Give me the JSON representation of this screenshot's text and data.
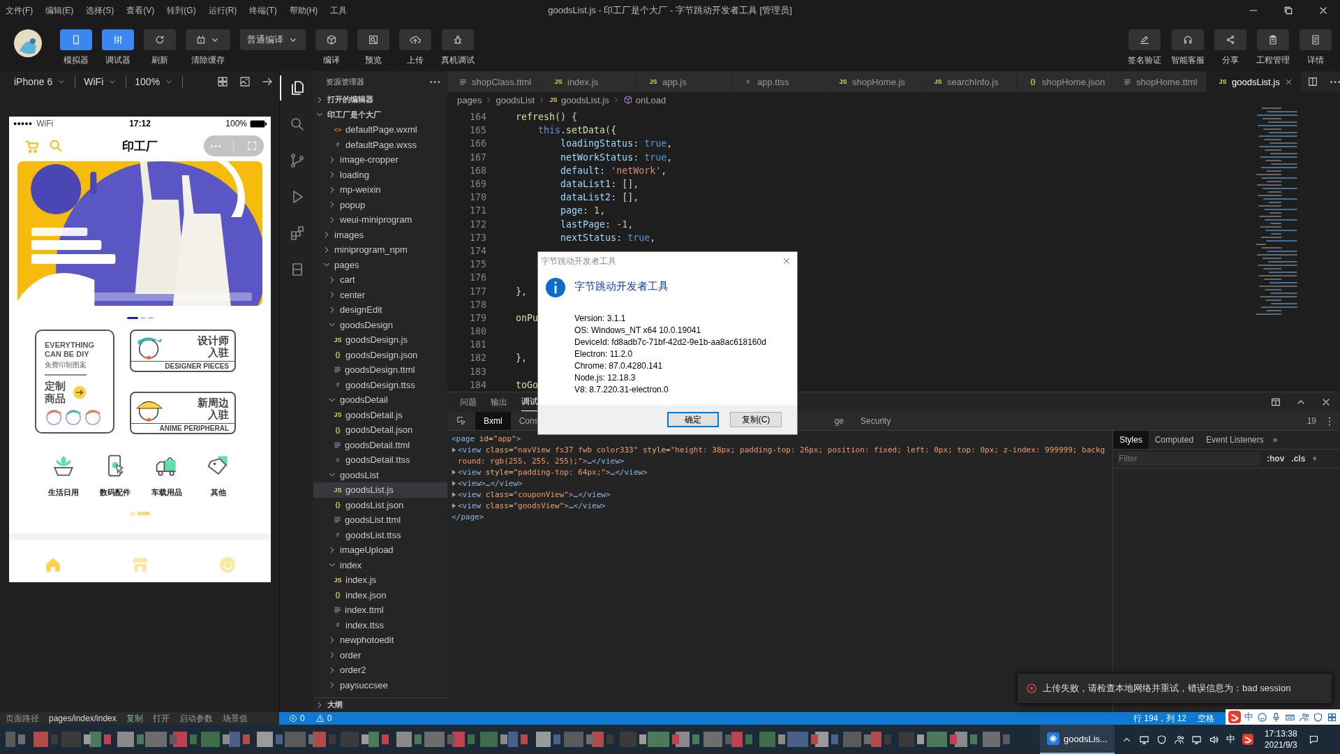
{
  "window": {
    "title": "goodsList.js - 印工厂是个大厂 - 字节跳动开发者工具 [管理员]"
  },
  "menu": [
    "文件(F)",
    "编辑(E)",
    "选择(S)",
    "查看(V)",
    "转到(G)",
    "运行(R)",
    "终端(T)",
    "帮助(H)",
    "工具"
  ],
  "toolbar": {
    "left": [
      {
        "label": "模拟器",
        "kind": "toggle",
        "on": true
      },
      {
        "label": "调试器",
        "kind": "toggle",
        "on": true
      },
      {
        "label": "刷新",
        "kind": "button"
      },
      {
        "label": "清除缓存",
        "kind": "dropdown"
      },
      {
        "label": "普通编译",
        "kind": "select"
      },
      {
        "label": "编译",
        "kind": "button"
      },
      {
        "label": "预览",
        "kind": "button"
      },
      {
        "label": "上传",
        "kind": "button"
      },
      {
        "label": "真机调试",
        "kind": "button"
      }
    ],
    "right": [
      "签名验证",
      "智能客服",
      "分享",
      "工程管理",
      "详情"
    ]
  },
  "device_bar": {
    "device": "iPhone 6",
    "network": "WiFi",
    "zoom": "100%"
  },
  "simulator": {
    "status": {
      "signal": "●●●●●",
      "network": "WiFi",
      "time": "17:12",
      "battery": "100%"
    },
    "nav_title": "印工厂",
    "banner_dots": [
      {
        "selected": true
      },
      {
        "selected": false
      },
      {
        "selected": false
      }
    ],
    "custom_card": {
      "title": "EVERYTHING CAN BE DIY",
      "subtitle": "免费印制图案",
      "action": "定制商品"
    },
    "join_cards": [
      {
        "title": "设计师入驻",
        "subtitle": "DESIGNER PIECES"
      },
      {
        "title": "新周边入驻",
        "subtitle": "ANIME PERIPHERAL"
      }
    ],
    "categories": [
      "生活日用",
      "数码配件",
      "车载用品",
      "其他"
    ],
    "category_dots": [
      {
        "selected": false
      },
      {
        "selected": true
      }
    ],
    "tabbar": [
      {
        "selected": true
      },
      {
        "selected": false
      },
      {
        "selected": false
      }
    ]
  },
  "explorer": {
    "title": "资源管理器",
    "open_editors": {
      "label": "打开的编辑器",
      "expanded": false
    },
    "project": {
      "label": "印工厂是个大厂",
      "expanded": true,
      "children": [
        {
          "children": [
            {
              "children": [
                {
                  "label": "defaultPage.wxml",
                  "kind": "wxml",
                  "badge": "<>",
                  "selected": false
                },
                {
                  "label": "defaultPage.wxss",
                  "kind": "wxss",
                  "badge": "#",
                  "selected": false
                }
              ]
            },
            {
              "label": "image-cropper",
              "kind": "folder",
              "expanded": false,
              "selected": false
            },
            {
              "label": "loading",
              "kind": "folder",
              "expanded": false,
              "selected": false
            },
            {
              "label": "mp-weixin",
              "kind": "folder",
              "expanded": false,
              "selected": false
            },
            {
              "label": "popup",
              "kind": "folder",
              "expanded": false,
              "selected": false
            },
            {
              "label": "weui-miniprogram",
              "kind": "folder",
              "expanded": false,
              "selected": false
            }
          ]
        },
        {
          "label": "images",
          "kind": "folder",
          "expanded": false,
          "selected": false
        },
        {
          "label": "miniprogram_npm",
          "kind": "folder",
          "expanded": false,
          "selected": false
        },
        {
          "label": "pages",
          "kind": "folder",
          "expanded": true,
          "selected": false,
          "children": [
            {
              "label": "cart",
              "kind": "folder",
              "expanded": false,
              "selected": false
            },
            {
              "label": "center",
              "kind": "folder",
              "expanded": false,
              "selected": false
            },
            {
              "label": "designEdit",
              "kind": "folder",
              "expanded": false,
              "selected": false
            },
            {
              "label": "goodsDesign",
              "kind": "folder",
              "expanded": true,
              "selected": false,
              "children": [
                {
                  "label": "goodsDesign.js",
                  "kind": "js",
                  "badge": "JS",
                  "selected": false
                },
                {
                  "label": "goodsDesign.json",
                  "kind": "json",
                  "badge": "{}",
                  "selected": false
                },
                {
                  "label": "goodsDesign.ttml",
                  "kind": "ttml",
                  "selected": false
                },
                {
                  "label": "goodsDesign.ttss",
                  "kind": "ttss",
                  "badge": "#",
                  "selected": false
                }
              ]
            },
            {
              "label": "goodsDetail",
              "kind": "folder",
              "expanded": true,
              "selected": false,
              "children": [
                {
                  "label": "goodsDetail.js",
                  "kind": "js",
                  "badge": "JS",
                  "selected": false
                },
                {
                  "label": "goodsDetail.json",
                  "kind": "json",
                  "badge": "{}",
                  "selected": false
                },
                {
                  "label": "goodsDetail.ttml",
                  "kind": "ttml",
                  "selected": false
                },
                {
                  "label": "goodsDetail.ttss",
                  "kind": "ttss",
                  "badge": "#",
                  "selected": false
                }
              ]
            },
            {
              "label": "goodsList",
              "kind": "folder",
              "expanded": true,
              "selected": false,
              "children": [
                {
                  "label": "goodsList.js",
                  "kind": "js",
                  "badge": "JS",
                  "selected": true
                },
                {
                  "label": "goodsList.json",
                  "kind": "json",
                  "badge": "{}",
                  "selected": false
                },
                {
                  "label": "goodsList.ttml",
                  "kind": "ttml",
                  "selected": false
                },
                {
                  "label": "goodsList.ttss",
                  "kind": "ttss",
                  "badge": "#",
                  "selected": false
                }
              ]
            },
            {
              "label": "imageUpload",
              "kind": "folder",
              "expanded": false,
              "selected": false
            },
            {
              "label": "index",
              "kind": "folder",
              "expanded": true,
              "selected": false,
              "children": [
                {
                  "label": "index.js",
                  "kind": "js",
                  "badge": "JS",
                  "selected": false
                },
                {
                  "label": "index.json",
                  "kind": "json",
                  "badge": "{}",
                  "selected": false
                },
                {
                  "label": "index.ttml",
                  "kind": "ttml",
                  "selected": false
                },
                {
                  "label": "index.ttss",
                  "kind": "ttss",
                  "badge": "#",
                  "selected": false
                }
              ]
            },
            {
              "label": "newphotoedit",
              "kind": "folder",
              "expanded": false,
              "selected": false
            },
            {
              "label": "order",
              "kind": "folder",
              "expanded": false,
              "selected": false
            },
            {
              "label": "order2",
              "kind": "folder",
              "expanded": false,
              "selected": false
            },
            {
              "label": "paysuccsee",
              "kind": "folder",
              "expanded": false,
              "selected": false
            }
          ]
        }
      ]
    },
    "outline": {
      "label": "大纲",
      "expanded": false
    }
  },
  "editor": {
    "tabs": [
      {
        "label": "shopClass.ttml",
        "kind": "ttml",
        "selected": false
      },
      {
        "label": "index.js",
        "kind": "js",
        "badge": "JS",
        "selected": false
      },
      {
        "label": "app.js",
        "kind": "js",
        "badge": "JS",
        "selected": false
      },
      {
        "label": "app.ttss",
        "kind": "ttss",
        "badge": "#",
        "selected": false
      },
      {
        "label": "shopHome.js",
        "kind": "js",
        "badge": "JS",
        "selected": false
      },
      {
        "label": "searchInfo.js",
        "kind": "js",
        "badge": "JS",
        "selected": false
      },
      {
        "label": "shopHome.json",
        "kind": "json",
        "badge": "{}",
        "selected": false
      },
      {
        "label": "shopHome.ttml",
        "kind": "ttml",
        "selected": false
      },
      {
        "label": "goodsList.js",
        "kind": "js",
        "badge": "JS",
        "selected": true
      }
    ],
    "breadcrumb": [
      {
        "label": "pages",
        "kind": "folder"
      },
      {
        "label": "goodsList",
        "kind": "folder"
      },
      {
        "label": "goodsList.js",
        "kind": "js",
        "badge": "JS"
      },
      {
        "label": "onLoad",
        "kind": "method"
      }
    ],
    "lines": [
      {
        "n": "164",
        "tokens": [
          {
            "text": "    refresh",
            "kind": "func"
          },
          {
            "text": "() {",
            "kind": "plain"
          }
        ]
      },
      {
        "n": "165",
        "tokens": [
          {
            "text": "        this",
            "kind": "keyword"
          },
          {
            "text": ".setData({",
            "kind": "func"
          }
        ]
      },
      {
        "n": "166",
        "tokens": [
          {
            "text": "            loadingStatus",
            "kind": "key"
          },
          {
            "text": ": ",
            "kind": "plain"
          },
          {
            "text": "true",
            "kind": "keyword"
          },
          {
            "text": ",",
            "kind": "plain"
          }
        ]
      },
      {
        "n": "167",
        "tokens": [
          {
            "text": "            netWorkStatus",
            "kind": "key"
          },
          {
            "text": ": ",
            "kind": "plain"
          },
          {
            "text": "true",
            "kind": "keyword"
          },
          {
            "text": ",",
            "kind": "plain"
          }
        ]
      },
      {
        "n": "168",
        "tokens": [
          {
            "text": "            default",
            "kind": "key"
          },
          {
            "text": ": ",
            "kind": "plain"
          },
          {
            "text": "'netWork'",
            "kind": "string"
          },
          {
            "text": ",",
            "kind": "plain"
          }
        ]
      },
      {
        "n": "169",
        "tokens": [
          {
            "text": "            dataList1",
            "kind": "key"
          },
          {
            "text": ": [],",
            "kind": "plain"
          }
        ]
      },
      {
        "n": "170",
        "tokens": [
          {
            "text": "            dataList2",
            "kind": "key"
          },
          {
            "text": ": [],",
            "kind": "plain"
          }
        ]
      },
      {
        "n": "171",
        "tokens": [
          {
            "text": "            page",
            "kind": "key"
          },
          {
            "text": ": ",
            "kind": "plain"
          },
          {
            "text": "1",
            "kind": "number"
          },
          {
            "text": ",",
            "kind": "plain"
          }
        ]
      },
      {
        "n": "172",
        "tokens": [
          {
            "text": "            lastPage",
            "kind": "key"
          },
          {
            "text": ": ",
            "kind": "plain"
          },
          {
            "text": "-1",
            "kind": "number"
          },
          {
            "text": ",",
            "kind": "plain"
          }
        ]
      },
      {
        "n": "173",
        "tokens": [
          {
            "text": "            nextStatus",
            "kind": "key"
          },
          {
            "text": ": ",
            "kind": "plain"
          },
          {
            "text": "true",
            "kind": "keyword"
          },
          {
            "text": ",",
            "kind": "plain"
          }
        ]
      },
      {
        "n": "174"
      },
      {
        "n": "175"
      },
      {
        "n": "176"
      },
      {
        "n": "177",
        "tokens": [
          {
            "text": "    },",
            "kind": "plain"
          }
        ]
      },
      {
        "n": "178"
      },
      {
        "n": "179",
        "tokens": [
          {
            "text": "    onPu",
            "kind": "func"
          }
        ]
      },
      {
        "n": "180"
      },
      {
        "n": "181"
      },
      {
        "n": "182",
        "tokens": [
          {
            "text": "    },",
            "kind": "plain"
          }
        ]
      },
      {
        "n": "183"
      },
      {
        "n": "184",
        "tokens": [
          {
            "text": "    toGo",
            "kind": "func"
          }
        ]
      }
    ]
  },
  "dialog": {
    "title": "字节跳动开发者工具",
    "heading": "字节跳动开发者工具",
    "lines": [
      "Version: 3.1.1",
      "OS: Windows_NT x64 10.0.19041",
      "DeviceId: fd8adb7c-71bf-42d2-9e1b-aa8ac618160d",
      "Electron: 11.2.0",
      "Chrome: 87.0.4280.141",
      "Node.js: 12.18.3",
      "V8: 8.7.220.31-electron.0"
    ],
    "buttons": [
      {
        "label": "确定",
        "default": true
      },
      {
        "label": "复制(C)",
        "default": false
      }
    ]
  },
  "devtools": {
    "panel_tabs": [
      {
        "label": "问题",
        "selected": false
      },
      {
        "label": "输出",
        "selected": false
      },
      {
        "label": "调试",
        "selected": true
      }
    ],
    "subtabs": [
      {
        "label": "Bxml",
        "selected": true
      },
      {
        "label": "Cons",
        "selected": false
      },
      {
        "label": "ge",
        "selected": false
      },
      {
        "label": "Security",
        "selected": false
      }
    ],
    "count": "19",
    "dom": [
      {
        "expandable": false,
        "tokens": [
          {
            "text": "<page ",
            "kind": "tag"
          },
          {
            "text": "id",
            "kind": "attr"
          },
          {
            "text": "=",
            "kind": "plain"
          },
          {
            "text": "\"app\"",
            "kind": "value"
          },
          {
            "text": ">",
            "kind": "tag"
          }
        ]
      },
      {
        "expandable": true,
        "tokens": [
          {
            "text": "<view ",
            "kind": "tag"
          },
          {
            "text": "class",
            "kind": "attr"
          },
          {
            "text": "=",
            "kind": "plain"
          },
          {
            "text": "\"navView fs37 fwb color333\"",
            "kind": "value"
          },
          {
            "text": " style",
            "kind": "attr"
          },
          {
            "text": "=",
            "kind": "plain"
          },
          {
            "text": "\"height: 38px; padding-top: 26px; position: fixed; left: 0px; top: 0px; z-index: 999999; background: rgb(255, 255, 255);\"",
            "kind": "value"
          },
          {
            "text": ">",
            "kind": "tag"
          },
          {
            "text": "…",
            "kind": "plain"
          },
          {
            "text": "</view>",
            "kind": "tag"
          }
        ]
      },
      {
        "expandable": true,
        "tokens": [
          {
            "text": "<view ",
            "kind": "tag"
          },
          {
            "text": "style",
            "kind": "attr"
          },
          {
            "text": "=",
            "kind": "plain"
          },
          {
            "text": "\"padding-top: 64px;\"",
            "kind": "value"
          },
          {
            "text": ">",
            "kind": "tag"
          },
          {
            "text": "…",
            "kind": "plain"
          },
          {
            "text": "</view>",
            "kind": "tag"
          }
        ]
      },
      {
        "expandable": true,
        "tokens": [
          {
            "text": "<view>",
            "kind": "tag"
          },
          {
            "text": "…",
            "kind": "plain"
          },
          {
            "text": "</view>",
            "kind": "tag"
          }
        ]
      },
      {
        "expandable": true,
        "tokens": [
          {
            "text": "<view ",
            "kind": "tag"
          },
          {
            "text": "class",
            "kind": "attr"
          },
          {
            "text": "=",
            "kind": "plain"
          },
          {
            "text": "\"couponView\"",
            "kind": "value"
          },
          {
            "text": ">",
            "kind": "tag"
          },
          {
            "text": "…",
            "kind": "plain"
          },
          {
            "text": "</view>",
            "kind": "tag"
          }
        ]
      },
      {
        "expandable": true,
        "tokens": [
          {
            "text": "<view ",
            "kind": "tag"
          },
          {
            "text": "class",
            "kind": "attr"
          },
          {
            "text": "=",
            "kind": "plain"
          },
          {
            "text": "\"goodsView\"",
            "kind": "value"
          },
          {
            "text": ">",
            "kind": "tag"
          },
          {
            "text": "…",
            "kind": "plain"
          },
          {
            "text": "</view>",
            "kind": "tag"
          }
        ]
      },
      {
        "expandable": false,
        "tokens": [
          {
            "text": "</page>",
            "kind": "tag"
          }
        ]
      }
    ],
    "side_tabs": [
      {
        "label": "Styles",
        "selected": true
      },
      {
        "label": "Computed",
        "selected": false
      },
      {
        "label": "Event Listeners",
        "selected": false
      }
    ],
    "more": "»",
    "filter": {
      "placeholder": "Filter"
    },
    "hov": ":hov",
    "cls": ".cls",
    "add": "+"
  },
  "notification": {
    "message": "上传失败，请检查本地网络并重试，错误信息为：bad session"
  },
  "sim_status": {
    "label": "页面路径",
    "path": "pages/index/index",
    "actions": [
      "复制",
      "打开"
    ],
    "extras": [
      "启动参数",
      "场景值"
    ]
  },
  "status_bar": {
    "errors": "0",
    "warnings": "0",
    "position": "行 194，列 12",
    "indent": "空格",
    "ime": "中"
  },
  "taskbar": {
    "app": "goodsLis...",
    "ime": "中",
    "time": "17:13:38",
    "date": "2021/9/3"
  }
}
